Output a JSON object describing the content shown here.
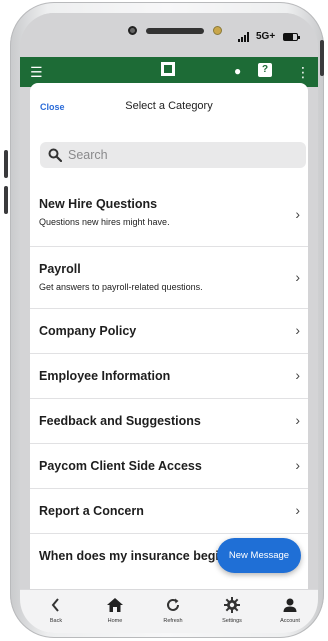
{
  "status_bar": {
    "network": "5G+"
  },
  "sheet": {
    "close_label": "Close",
    "title": "Select a Category"
  },
  "search": {
    "placeholder": "Search"
  },
  "categories": [
    {
      "title": "New Hire Questions",
      "subtitle": "Questions new hires might have."
    },
    {
      "title": "Payroll",
      "subtitle": "Get answers to payroll-related questions."
    },
    {
      "title": "Company Policy"
    },
    {
      "title": "Employee Information"
    },
    {
      "title": "Feedback and Suggestions"
    },
    {
      "title": "Paycom Client Side Access"
    },
    {
      "title": "Report a Concern"
    },
    {
      "title": "When does my insurance begin?"
    }
  ],
  "fab": {
    "label": "New Message"
  },
  "bottom_nav": [
    {
      "label": "Back",
      "icon": "chevron-left-icon"
    },
    {
      "label": "Home",
      "icon": "home-icon"
    },
    {
      "label": "Refresh",
      "icon": "refresh-icon"
    },
    {
      "label": "Settings",
      "icon": "gear-icon"
    },
    {
      "label": "Account",
      "icon": "person-icon"
    }
  ],
  "colors": {
    "app_bar": "#1d6b36",
    "accent": "#1f6fd6",
    "link": "#2a6bd8"
  }
}
